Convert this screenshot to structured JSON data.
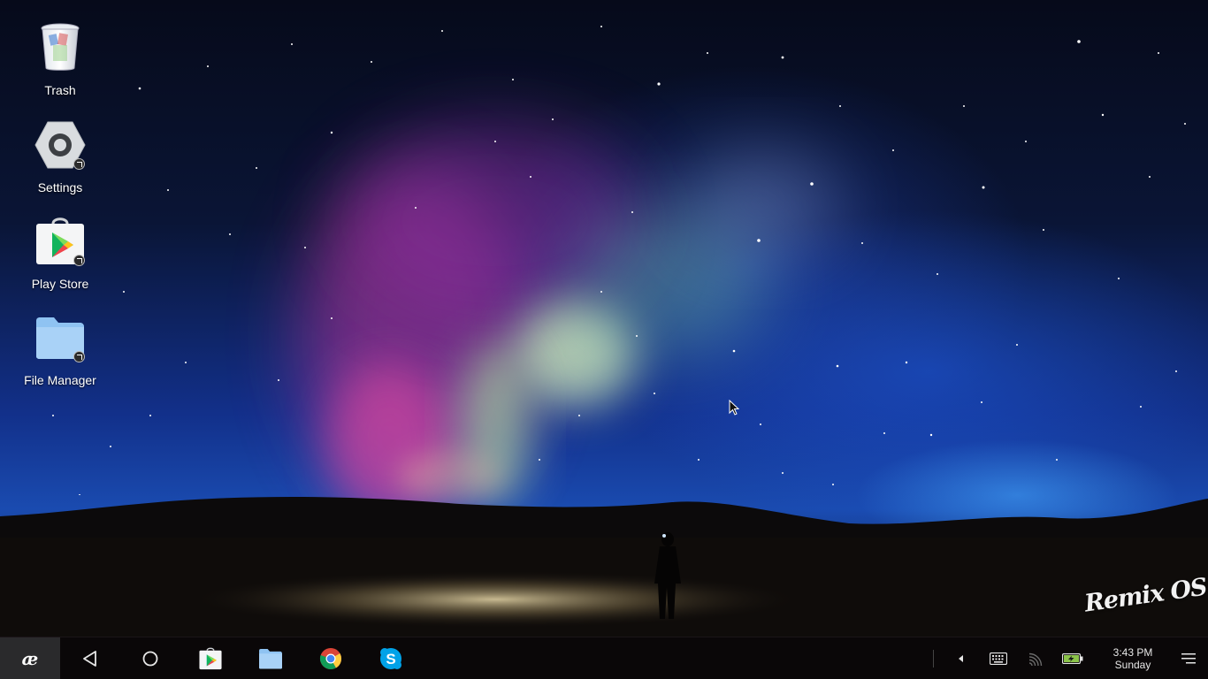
{
  "desktop": {
    "icons": [
      {
        "label": "Trash",
        "icon": "trash-icon"
      },
      {
        "label": "Settings",
        "icon": "settings-icon"
      },
      {
        "label": "Play Store",
        "icon": "play-store-icon"
      },
      {
        "label": "File Manager",
        "icon": "file-manager-icon"
      }
    ],
    "watermark": "Remix OS"
  },
  "taskbar": {
    "start": {
      "label": "æ",
      "icon": "remix-start-icon"
    },
    "nav": [
      {
        "icon": "back-icon"
      },
      {
        "icon": "home-icon"
      }
    ],
    "pinned_apps": [
      {
        "icon": "play-store-icon"
      },
      {
        "icon": "file-manager-icon"
      },
      {
        "icon": "chrome-icon"
      },
      {
        "icon": "skype-icon"
      }
    ],
    "tray": {
      "items": [
        {
          "icon": "tray-expand-icon"
        },
        {
          "icon": "keyboard-icon"
        },
        {
          "icon": "cast-icon"
        },
        {
          "icon": "battery-charging-icon"
        }
      ],
      "clock": {
        "time": "3:43 PM",
        "day": "Sunday"
      },
      "notifications_icon": "notifications-menu-icon"
    }
  },
  "colors": {
    "taskbar_bg": "#0a0708",
    "start_bg": "#2a2a2c",
    "folder_blue": "#8fc3f2",
    "battery_green": "#8bc34a",
    "skype_blue": "#00a2e8"
  }
}
